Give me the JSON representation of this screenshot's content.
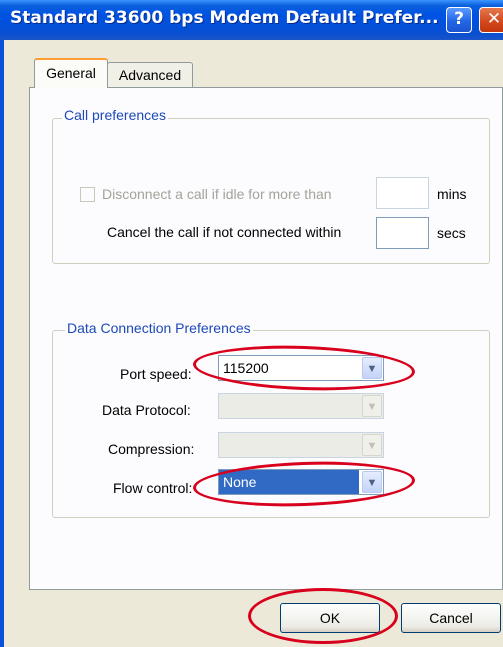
{
  "window": {
    "title": "Standard 33600 bps Modem Default Prefer...",
    "help_label": "?",
    "close_label": "✕"
  },
  "tabs": [
    {
      "label": "General",
      "selected": true
    },
    {
      "label": "Advanced",
      "selected": false
    }
  ],
  "call_preferences": {
    "legend": "Call preferences",
    "disconnect_label": "Disconnect a call if idle for more than",
    "disconnect_checked": false,
    "disconnect_enabled": false,
    "disconnect_value": "",
    "disconnect_unit": "mins",
    "cancel_label": "Cancel the call if not connected within",
    "cancel_value": "",
    "cancel_unit": "secs"
  },
  "data_connection": {
    "legend": "Data Connection Preferences",
    "port_speed_label": "Port speed:",
    "port_speed_value": "115200",
    "data_protocol_label": "Data Protocol:",
    "data_protocol_value": "",
    "compression_label": "Compression:",
    "compression_value": "",
    "flow_control_label": "Flow control:",
    "flow_control_value": "None"
  },
  "buttons": {
    "ok": "OK",
    "cancel": "Cancel"
  },
  "annotations": {
    "color": "#d8001c"
  },
  "icons": {
    "dropdown": "▼"
  }
}
